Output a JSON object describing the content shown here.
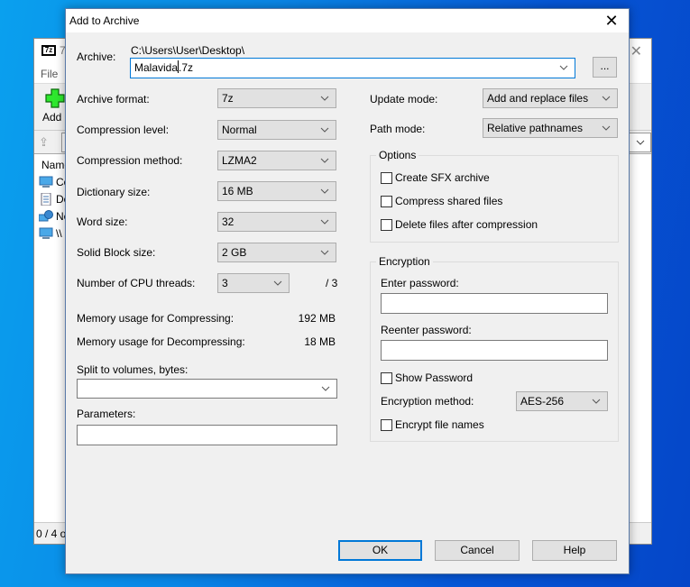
{
  "background_window": {
    "logo_text": "7z",
    "title_fragment": "7",
    "menu": [
      "File"
    ],
    "toolbar": {
      "add_label": "Add"
    },
    "list_header": "Name",
    "items": [
      {
        "icon": "computer-icon",
        "text": "Co"
      },
      {
        "icon": "document-icon",
        "text": "Do"
      },
      {
        "icon": "network-icon",
        "text": "Ne"
      },
      {
        "icon": "computer-icon",
        "text": "\\\\"
      }
    ],
    "status": "0 / 4 o"
  },
  "dialog": {
    "title": "Add to Archive",
    "close_icon": "✕",
    "archive": {
      "label": "Archive:",
      "path": "C:\\Users\\User\\Desktop\\",
      "value_name": "Malavida",
      "value_ext": ".7z",
      "browse_label": "..."
    },
    "left": {
      "archive_format": {
        "label": "Archive format:",
        "value": "7z"
      },
      "compression_level": {
        "label": "Compression level:",
        "value": "Normal"
      },
      "compression_method": {
        "label": "Compression method:",
        "value": "LZMA2"
      },
      "dictionary_size": {
        "label": "Dictionary size:",
        "value": "16 MB"
      },
      "word_size": {
        "label": "Word size:",
        "value": "32"
      },
      "solid_block_size": {
        "label": "Solid Block size:",
        "value": "2 GB"
      },
      "cpu_threads": {
        "label": "Number of CPU threads:",
        "value": "3",
        "max": "/ 3"
      },
      "mem_compress": {
        "label": "Memory usage for Compressing:",
        "value": "192 MB"
      },
      "mem_decompress": {
        "label": "Memory usage for Decompressing:",
        "value": "18 MB"
      },
      "split_volumes": {
        "label": "Split to volumes, bytes:",
        "value": ""
      },
      "parameters": {
        "label": "Parameters:",
        "value": ""
      }
    },
    "right": {
      "update_mode": {
        "label": "Update mode:",
        "value": "Add and replace files"
      },
      "path_mode": {
        "label": "Path mode:",
        "value": "Relative pathnames"
      },
      "options": {
        "title": "Options",
        "checkboxes": [
          {
            "label": "Create SFX archive",
            "checked": false
          },
          {
            "label": "Compress shared files",
            "checked": false
          },
          {
            "label": "Delete files after compression",
            "checked": false
          }
        ]
      },
      "encryption": {
        "title": "Encryption",
        "enter_password_label": "Enter password:",
        "enter_password_value": "",
        "reenter_password_label": "Reenter password:",
        "reenter_password_value": "",
        "show_password": {
          "label": "Show Password",
          "checked": false
        },
        "method": {
          "label": "Encryption method:",
          "value": "AES-256"
        },
        "encrypt_names": {
          "label": "Encrypt file names",
          "checked": false
        }
      }
    },
    "buttons": {
      "ok": "OK",
      "cancel": "Cancel",
      "help": "Help"
    }
  }
}
